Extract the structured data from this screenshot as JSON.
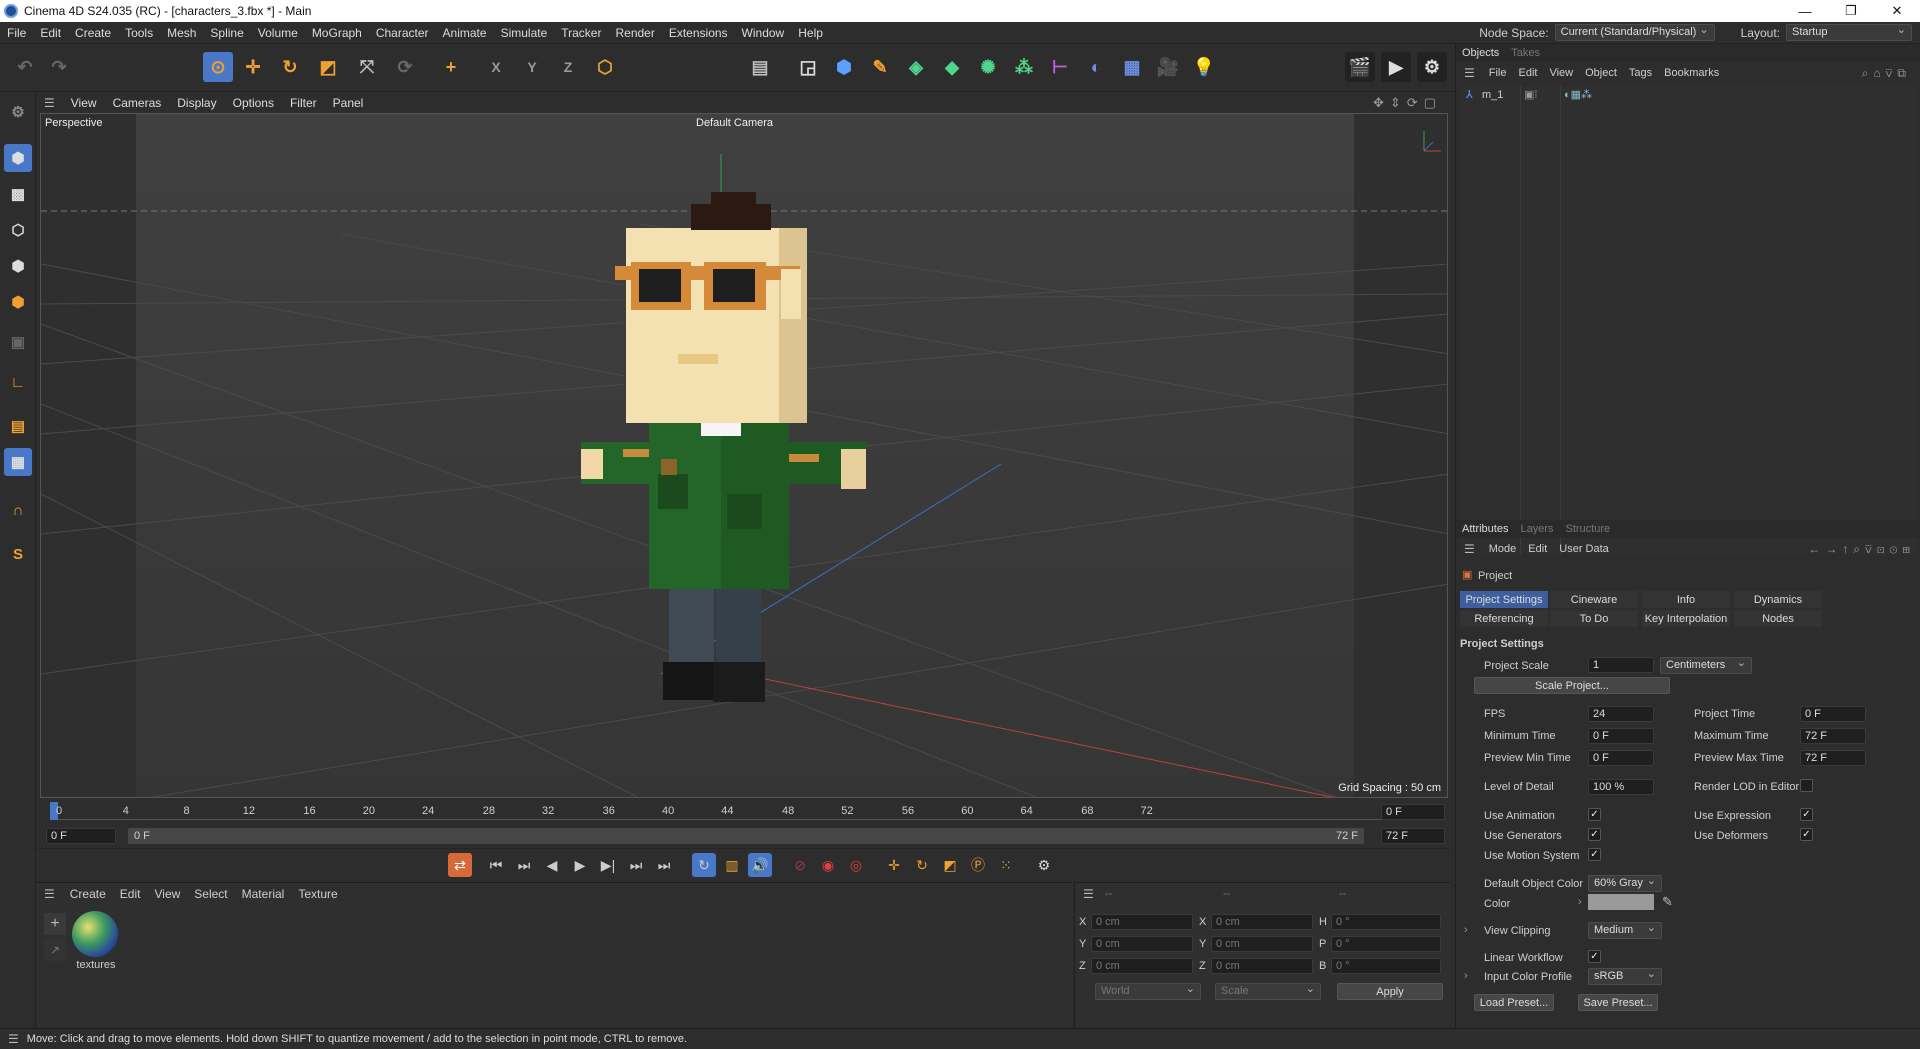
{
  "window": {
    "title": "Cinema 4D S24.035 (RC) - [characters_3.fbx *] - Main",
    "minimize": "—",
    "maximize": "❐",
    "close": "✕"
  },
  "menu": [
    "File",
    "Edit",
    "Create",
    "Tools",
    "Mesh",
    "Spline",
    "Volume",
    "MoGraph",
    "Character",
    "Animate",
    "Simulate",
    "Tracker",
    "Render",
    "Extensions",
    "Window",
    "Help"
  ],
  "header_right": {
    "node_space_label": "Node Space:",
    "node_space_value": "Current (Standard/Physical)",
    "layout_label": "Layout:",
    "layout_value": "Startup"
  },
  "viewport_menu": [
    "View",
    "Cameras",
    "Display",
    "Options",
    "Filter",
    "Panel"
  ],
  "viewport": {
    "name": "Perspective",
    "camera": "Default Camera",
    "grid_spacing": "Grid Spacing : 50 cm"
  },
  "timeline": {
    "ticks": [
      "0",
      "4",
      "8",
      "12",
      "16",
      "20",
      "24",
      "28",
      "32",
      "36",
      "40",
      "44",
      "48",
      "52",
      "56",
      "60",
      "64",
      "68",
      "72"
    ],
    "current_frame": "0 F",
    "start_field": "0 F",
    "range_start": "0 F",
    "range_end": "72 F",
    "end_field": "72 F"
  },
  "material_panel": {
    "menu": [
      "Create",
      "Edit",
      "View",
      "Select",
      "Material",
      "Texture"
    ],
    "material_name": "textures"
  },
  "coord_panel": {
    "headers": [
      "--",
      "--",
      "--"
    ],
    "rows": [
      {
        "a": "X",
        "av": "0 cm",
        "b": "X",
        "bv": "0 cm",
        "c": "H",
        "cv": "0 °"
      },
      {
        "a": "Y",
        "av": "0 cm",
        "b": "Y",
        "bv": "0 cm",
        "c": "P",
        "cv": "0 °"
      },
      {
        "a": "Z",
        "av": "0 cm",
        "b": "Z",
        "bv": "0 cm",
        "c": "B",
        "cv": "0 °"
      }
    ],
    "world": "World",
    "scale": "Scale",
    "apply": "Apply"
  },
  "objects_panel": {
    "tabs": [
      "Objects",
      "Takes"
    ],
    "menu": [
      "File",
      "Edit",
      "View",
      "Object",
      "Tags",
      "Bookmarks"
    ],
    "object_name": "m_1"
  },
  "attributes_panel": {
    "tabs": [
      "Attributes",
      "Layers",
      "Structure"
    ],
    "menu": [
      "Mode",
      "Edit",
      "User Data"
    ],
    "object": "Project",
    "subtabs_row1": [
      "Project Settings",
      "Cineware",
      "Info",
      "Dynamics"
    ],
    "subtabs_row2": [
      "Referencing",
      "To Do",
      "Key Interpolation",
      "Nodes"
    ],
    "section": "Project Settings",
    "project_scale_label": "Project Scale",
    "project_scale_value": "1",
    "project_scale_unit": "Centimeters",
    "scale_project_btn": "Scale Project...",
    "fps_label": "FPS",
    "fps_value": "24",
    "project_time_label": "Project Time",
    "project_time_value": "0 F",
    "min_time_label": "Minimum Time",
    "min_time_value": "0 F",
    "max_time_label": "Maximum Time",
    "max_time_value": "72 F",
    "prev_min_label": "Preview Min Time",
    "prev_min_value": "0 F",
    "prev_max_label": "Preview Max Time",
    "prev_max_value": "72 F",
    "lod_label": "Level of Detail",
    "lod_value": "100 %",
    "render_lod_label": "Render LOD in Editor",
    "use_animation": "Use Animation",
    "use_expression": "Use Expression",
    "use_generators": "Use Generators",
    "use_deformers": "Use Deformers",
    "use_motion": "Use Motion System",
    "default_color_label": "Default Object Color",
    "default_color_value": "60% Gray",
    "color_label": "Color",
    "view_clipping_label": "View Clipping",
    "view_clipping_value": "Medium",
    "linear_workflow": "Linear Workflow",
    "input_profile_label": "Input Color Profile",
    "input_profile_value": "sRGB",
    "load_preset": "Load Preset...",
    "save_preset": "Save Preset..."
  },
  "status": "Move: Click and drag to move elements. Hold down SHIFT to quantize movement / add to the selection in point mode, CTRL to remove.",
  "colors": {
    "accent": "#4a78c8",
    "selected_tab": "#3d5f9e",
    "bg": "#2d2d2d"
  }
}
